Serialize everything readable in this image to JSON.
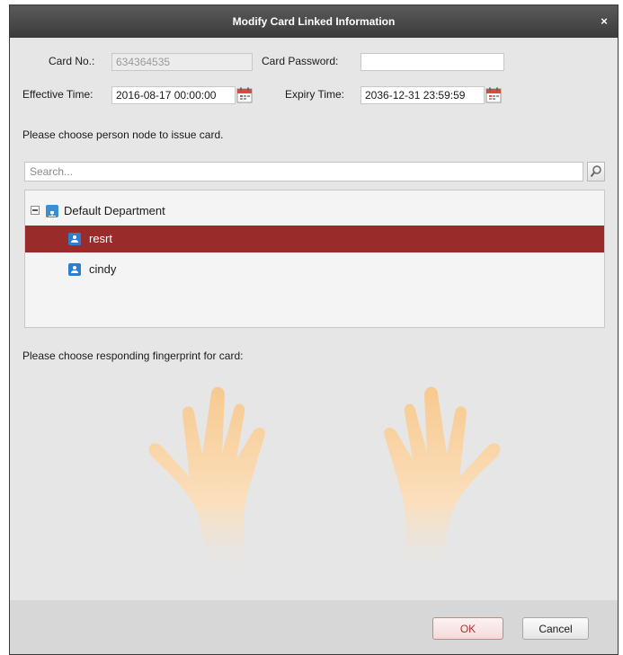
{
  "dialog": {
    "title": "Modify Card Linked Information",
    "close_glyph": "×"
  },
  "card": {
    "card_no_label": "Card No.:",
    "card_no_value": "634364535",
    "password_label": "Card Password:",
    "password_value": "",
    "effective_label": "Effective Time:",
    "effective_value": "2016-08-17 00:00:00",
    "expiry_label": "Expiry Time:",
    "expiry_value": "2036-12-31 23:59:59"
  },
  "person": {
    "prompt": "Please choose person node to issue card.",
    "search_placeholder": "Search...",
    "tree": {
      "department": "Default Department",
      "persons": [
        {
          "name": "resrt",
          "selected": true
        },
        {
          "name": "cindy",
          "selected": false
        }
      ]
    }
  },
  "fingerprint": {
    "prompt": "Please choose responding fingerprint for card:",
    "hand_color": "#f7c98f"
  },
  "buttons": {
    "ok": "OK",
    "cancel": "Cancel"
  },
  "colors": {
    "title_bar": "#3b3b3b",
    "selection": "#9a2b2b",
    "ok_text": "#b03030"
  },
  "icons": [
    "calendar-icon",
    "search-icon",
    "department-icon",
    "person-icon",
    "collapse-icon",
    "close-icon"
  ]
}
